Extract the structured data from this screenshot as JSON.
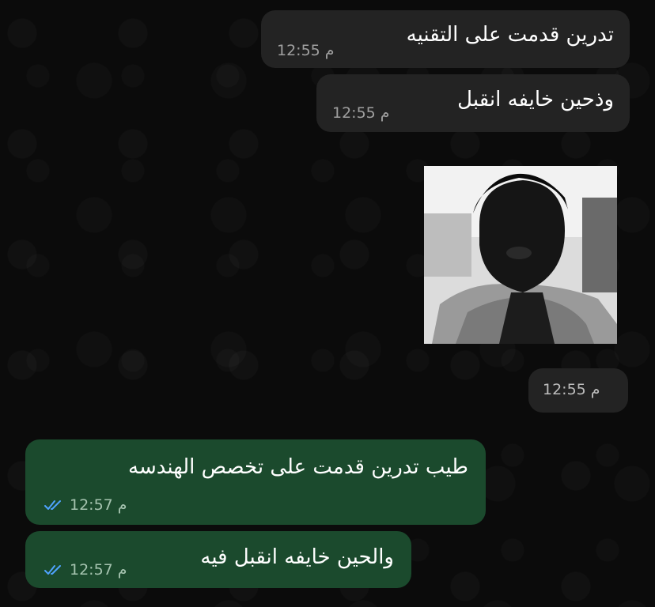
{
  "messages": [
    {
      "text": "تدرين قدمت على التقنيه",
      "time": "12:55 م"
    },
    {
      "text": "وذحين خايفه انقبل",
      "time": "12:55 م"
    },
    {
      "image": "person-photo",
      "time": "12:55 م"
    },
    {
      "text": "طيب تدرين قدمت على تخصص الهندسه",
      "time": "12:57 م"
    },
    {
      "text": "والحين خايفه انقبل فيه",
      "time": "12:57 م"
    }
  ],
  "colors": {
    "incoming": "#232323",
    "outgoing": "#1b4a2d",
    "read_ticks": "#4fa3ff"
  },
  "icons": {
    "read_receipt": "double-check-icon"
  }
}
